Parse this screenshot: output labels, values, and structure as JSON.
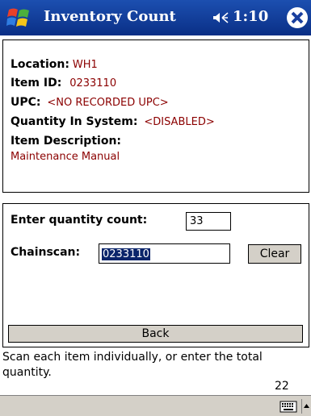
{
  "titlebar": {
    "title": "Inventory Count",
    "time": "1:10",
    "icons": {
      "start": "windows-flag-icon",
      "volume": "speaker-icon",
      "close": "close-icon"
    }
  },
  "info": {
    "location_label": "Location:",
    "location_value": "WH1",
    "item_id_label": "Item ID:",
    "item_id_value": "0233110",
    "upc_label": "UPC:",
    "upc_value": "<NO RECORDED UPC>",
    "qty_system_label": "Quantity In System:",
    "qty_system_value": "<DISABLED>",
    "desc_label": "Item Description:",
    "desc_value": "Maintenance Manual"
  },
  "entry": {
    "qty_label": "Enter quantity count:",
    "qty_value": "33",
    "chainscan_label": "Chainscan:",
    "chainscan_value": "0233110",
    "clear_label": "Clear",
    "back_label": "Back"
  },
  "status": {
    "message": "Scan each item individually, or enter the total quantity.",
    "count": "22"
  },
  "menubar": {
    "keyboard_icon": "keyboard-icon",
    "sip_icon": "arrow-up-icon"
  },
  "colors": {
    "titlebar": "#1c4fb0",
    "value_text": "#8b0000",
    "selection": "#0a246a",
    "button_face": "#d4d0c8"
  }
}
